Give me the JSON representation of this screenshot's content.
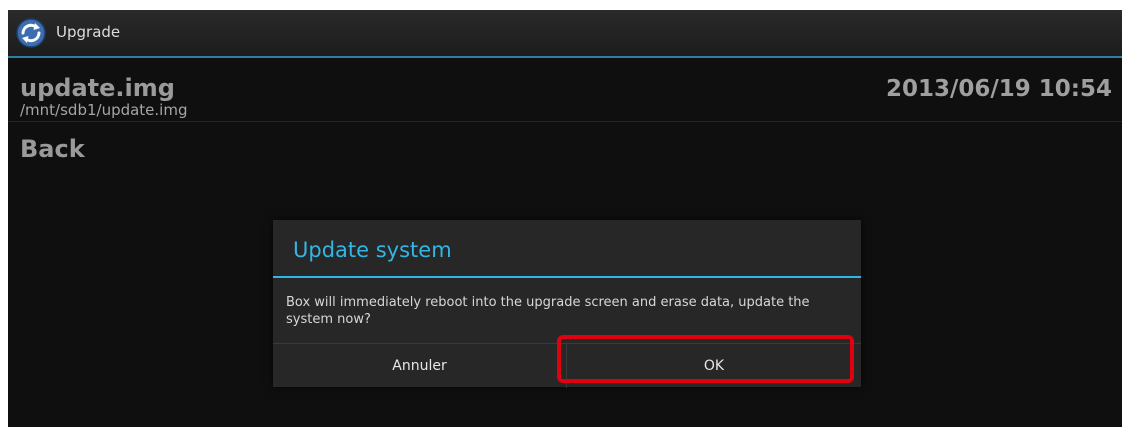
{
  "titlebar": {
    "title": "Upgrade",
    "icon": "sync-icon",
    "accent_color": "#2f7fa0"
  },
  "file": {
    "name": "update.img",
    "path": "/mnt/sdb1/update.img"
  },
  "status": {
    "datetime": "2013/06/19 10:54"
  },
  "nav": {
    "back_label": "Back"
  },
  "dialog": {
    "title": "Update system",
    "message": "Box will immediately reboot into the upgrade screen and erase data, update the system now?",
    "cancel_label": "Annuler",
    "ok_label": "OK",
    "accent_color": "#33b5e5"
  },
  "annotation": {
    "highlight_color": "#e0000f"
  }
}
